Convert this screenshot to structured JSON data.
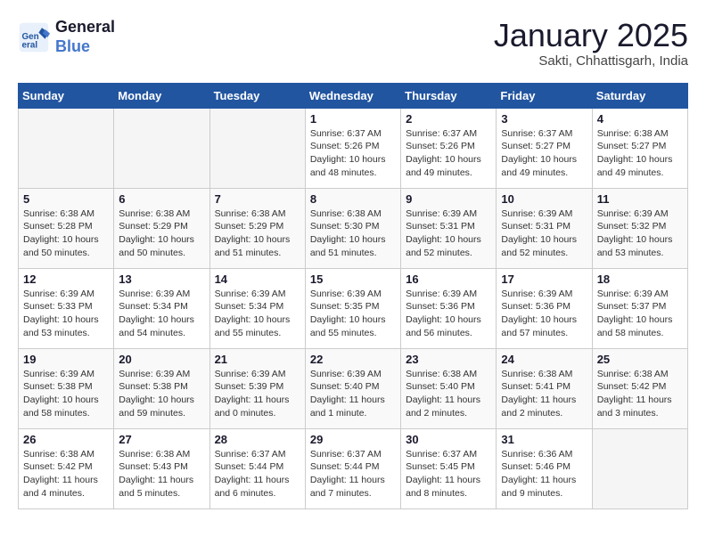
{
  "header": {
    "logo_line1": "General",
    "logo_line2": "Blue",
    "month_title": "January 2025",
    "location": "Sakti, Chhattisgarh, India"
  },
  "weekdays": [
    "Sunday",
    "Monday",
    "Tuesday",
    "Wednesday",
    "Thursday",
    "Friday",
    "Saturday"
  ],
  "weeks": [
    [
      {
        "num": "",
        "info": ""
      },
      {
        "num": "",
        "info": ""
      },
      {
        "num": "",
        "info": ""
      },
      {
        "num": "1",
        "info": "Sunrise: 6:37 AM\nSunset: 5:26 PM\nDaylight: 10 hours\nand 48 minutes."
      },
      {
        "num": "2",
        "info": "Sunrise: 6:37 AM\nSunset: 5:26 PM\nDaylight: 10 hours\nand 49 minutes."
      },
      {
        "num": "3",
        "info": "Sunrise: 6:37 AM\nSunset: 5:27 PM\nDaylight: 10 hours\nand 49 minutes."
      },
      {
        "num": "4",
        "info": "Sunrise: 6:38 AM\nSunset: 5:27 PM\nDaylight: 10 hours\nand 49 minutes."
      }
    ],
    [
      {
        "num": "5",
        "info": "Sunrise: 6:38 AM\nSunset: 5:28 PM\nDaylight: 10 hours\nand 50 minutes."
      },
      {
        "num": "6",
        "info": "Sunrise: 6:38 AM\nSunset: 5:29 PM\nDaylight: 10 hours\nand 50 minutes."
      },
      {
        "num": "7",
        "info": "Sunrise: 6:38 AM\nSunset: 5:29 PM\nDaylight: 10 hours\nand 51 minutes."
      },
      {
        "num": "8",
        "info": "Sunrise: 6:38 AM\nSunset: 5:30 PM\nDaylight: 10 hours\nand 51 minutes."
      },
      {
        "num": "9",
        "info": "Sunrise: 6:39 AM\nSunset: 5:31 PM\nDaylight: 10 hours\nand 52 minutes."
      },
      {
        "num": "10",
        "info": "Sunrise: 6:39 AM\nSunset: 5:31 PM\nDaylight: 10 hours\nand 52 minutes."
      },
      {
        "num": "11",
        "info": "Sunrise: 6:39 AM\nSunset: 5:32 PM\nDaylight: 10 hours\nand 53 minutes."
      }
    ],
    [
      {
        "num": "12",
        "info": "Sunrise: 6:39 AM\nSunset: 5:33 PM\nDaylight: 10 hours\nand 53 minutes."
      },
      {
        "num": "13",
        "info": "Sunrise: 6:39 AM\nSunset: 5:34 PM\nDaylight: 10 hours\nand 54 minutes."
      },
      {
        "num": "14",
        "info": "Sunrise: 6:39 AM\nSunset: 5:34 PM\nDaylight: 10 hours\nand 55 minutes."
      },
      {
        "num": "15",
        "info": "Sunrise: 6:39 AM\nSunset: 5:35 PM\nDaylight: 10 hours\nand 55 minutes."
      },
      {
        "num": "16",
        "info": "Sunrise: 6:39 AM\nSunset: 5:36 PM\nDaylight: 10 hours\nand 56 minutes."
      },
      {
        "num": "17",
        "info": "Sunrise: 6:39 AM\nSunset: 5:36 PM\nDaylight: 10 hours\nand 57 minutes."
      },
      {
        "num": "18",
        "info": "Sunrise: 6:39 AM\nSunset: 5:37 PM\nDaylight: 10 hours\nand 58 minutes."
      }
    ],
    [
      {
        "num": "19",
        "info": "Sunrise: 6:39 AM\nSunset: 5:38 PM\nDaylight: 10 hours\nand 58 minutes."
      },
      {
        "num": "20",
        "info": "Sunrise: 6:39 AM\nSunset: 5:38 PM\nDaylight: 10 hours\nand 59 minutes."
      },
      {
        "num": "21",
        "info": "Sunrise: 6:39 AM\nSunset: 5:39 PM\nDaylight: 11 hours\nand 0 minutes."
      },
      {
        "num": "22",
        "info": "Sunrise: 6:39 AM\nSunset: 5:40 PM\nDaylight: 11 hours\nand 1 minute."
      },
      {
        "num": "23",
        "info": "Sunrise: 6:38 AM\nSunset: 5:40 PM\nDaylight: 11 hours\nand 2 minutes."
      },
      {
        "num": "24",
        "info": "Sunrise: 6:38 AM\nSunset: 5:41 PM\nDaylight: 11 hours\nand 2 minutes."
      },
      {
        "num": "25",
        "info": "Sunrise: 6:38 AM\nSunset: 5:42 PM\nDaylight: 11 hours\nand 3 minutes."
      }
    ],
    [
      {
        "num": "26",
        "info": "Sunrise: 6:38 AM\nSunset: 5:42 PM\nDaylight: 11 hours\nand 4 minutes."
      },
      {
        "num": "27",
        "info": "Sunrise: 6:38 AM\nSunset: 5:43 PM\nDaylight: 11 hours\nand 5 minutes."
      },
      {
        "num": "28",
        "info": "Sunrise: 6:37 AM\nSunset: 5:44 PM\nDaylight: 11 hours\nand 6 minutes."
      },
      {
        "num": "29",
        "info": "Sunrise: 6:37 AM\nSunset: 5:44 PM\nDaylight: 11 hours\nand 7 minutes."
      },
      {
        "num": "30",
        "info": "Sunrise: 6:37 AM\nSunset: 5:45 PM\nDaylight: 11 hours\nand 8 minutes."
      },
      {
        "num": "31",
        "info": "Sunrise: 6:36 AM\nSunset: 5:46 PM\nDaylight: 11 hours\nand 9 minutes."
      },
      {
        "num": "",
        "info": ""
      }
    ]
  ]
}
